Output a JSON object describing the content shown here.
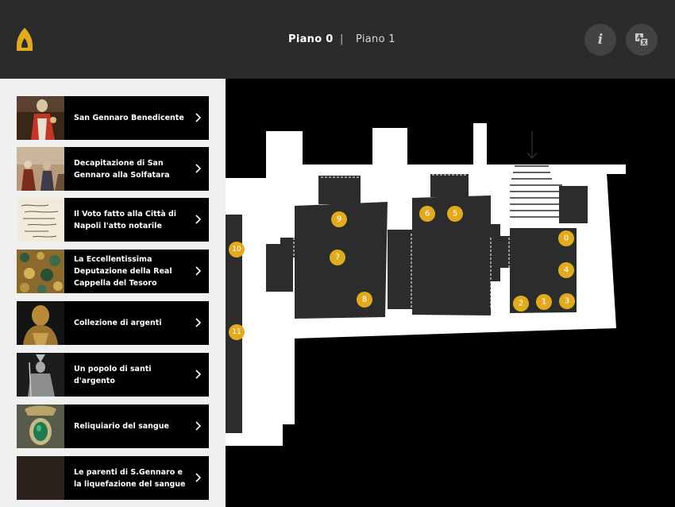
{
  "header": {
    "floors": [
      {
        "label": "Piano 0",
        "active": true
      },
      {
        "label": "Piano 1",
        "active": false
      }
    ],
    "separator": "|",
    "info_label": "i",
    "accent_color": "#e2ab1f",
    "icons": [
      "logo-icon",
      "info-icon",
      "translate-icon"
    ]
  },
  "sidebar": {
    "items": [
      {
        "title": "San Gennaro Benedicente"
      },
      {
        "title": "Decapitazione di San Gennaro alla Solfatara"
      },
      {
        "title": "Il Voto fatto alla Città di Napoli  l'atto notarile"
      },
      {
        "title": "La Eccellentissima Deputazione della Real Cappella del Tesoro"
      },
      {
        "title": "Collezione di argenti"
      },
      {
        "title": "Un popolo di santi d'argento"
      },
      {
        "title": "Reliquiario del sangue"
      },
      {
        "title": "Le parenti di S.Gennaro e la liquefazione del sangue"
      }
    ]
  },
  "map": {
    "pins": [
      "0",
      "1",
      "2",
      "3",
      "4",
      "5",
      "6",
      "7",
      "8",
      "9",
      "10",
      "11"
    ]
  }
}
